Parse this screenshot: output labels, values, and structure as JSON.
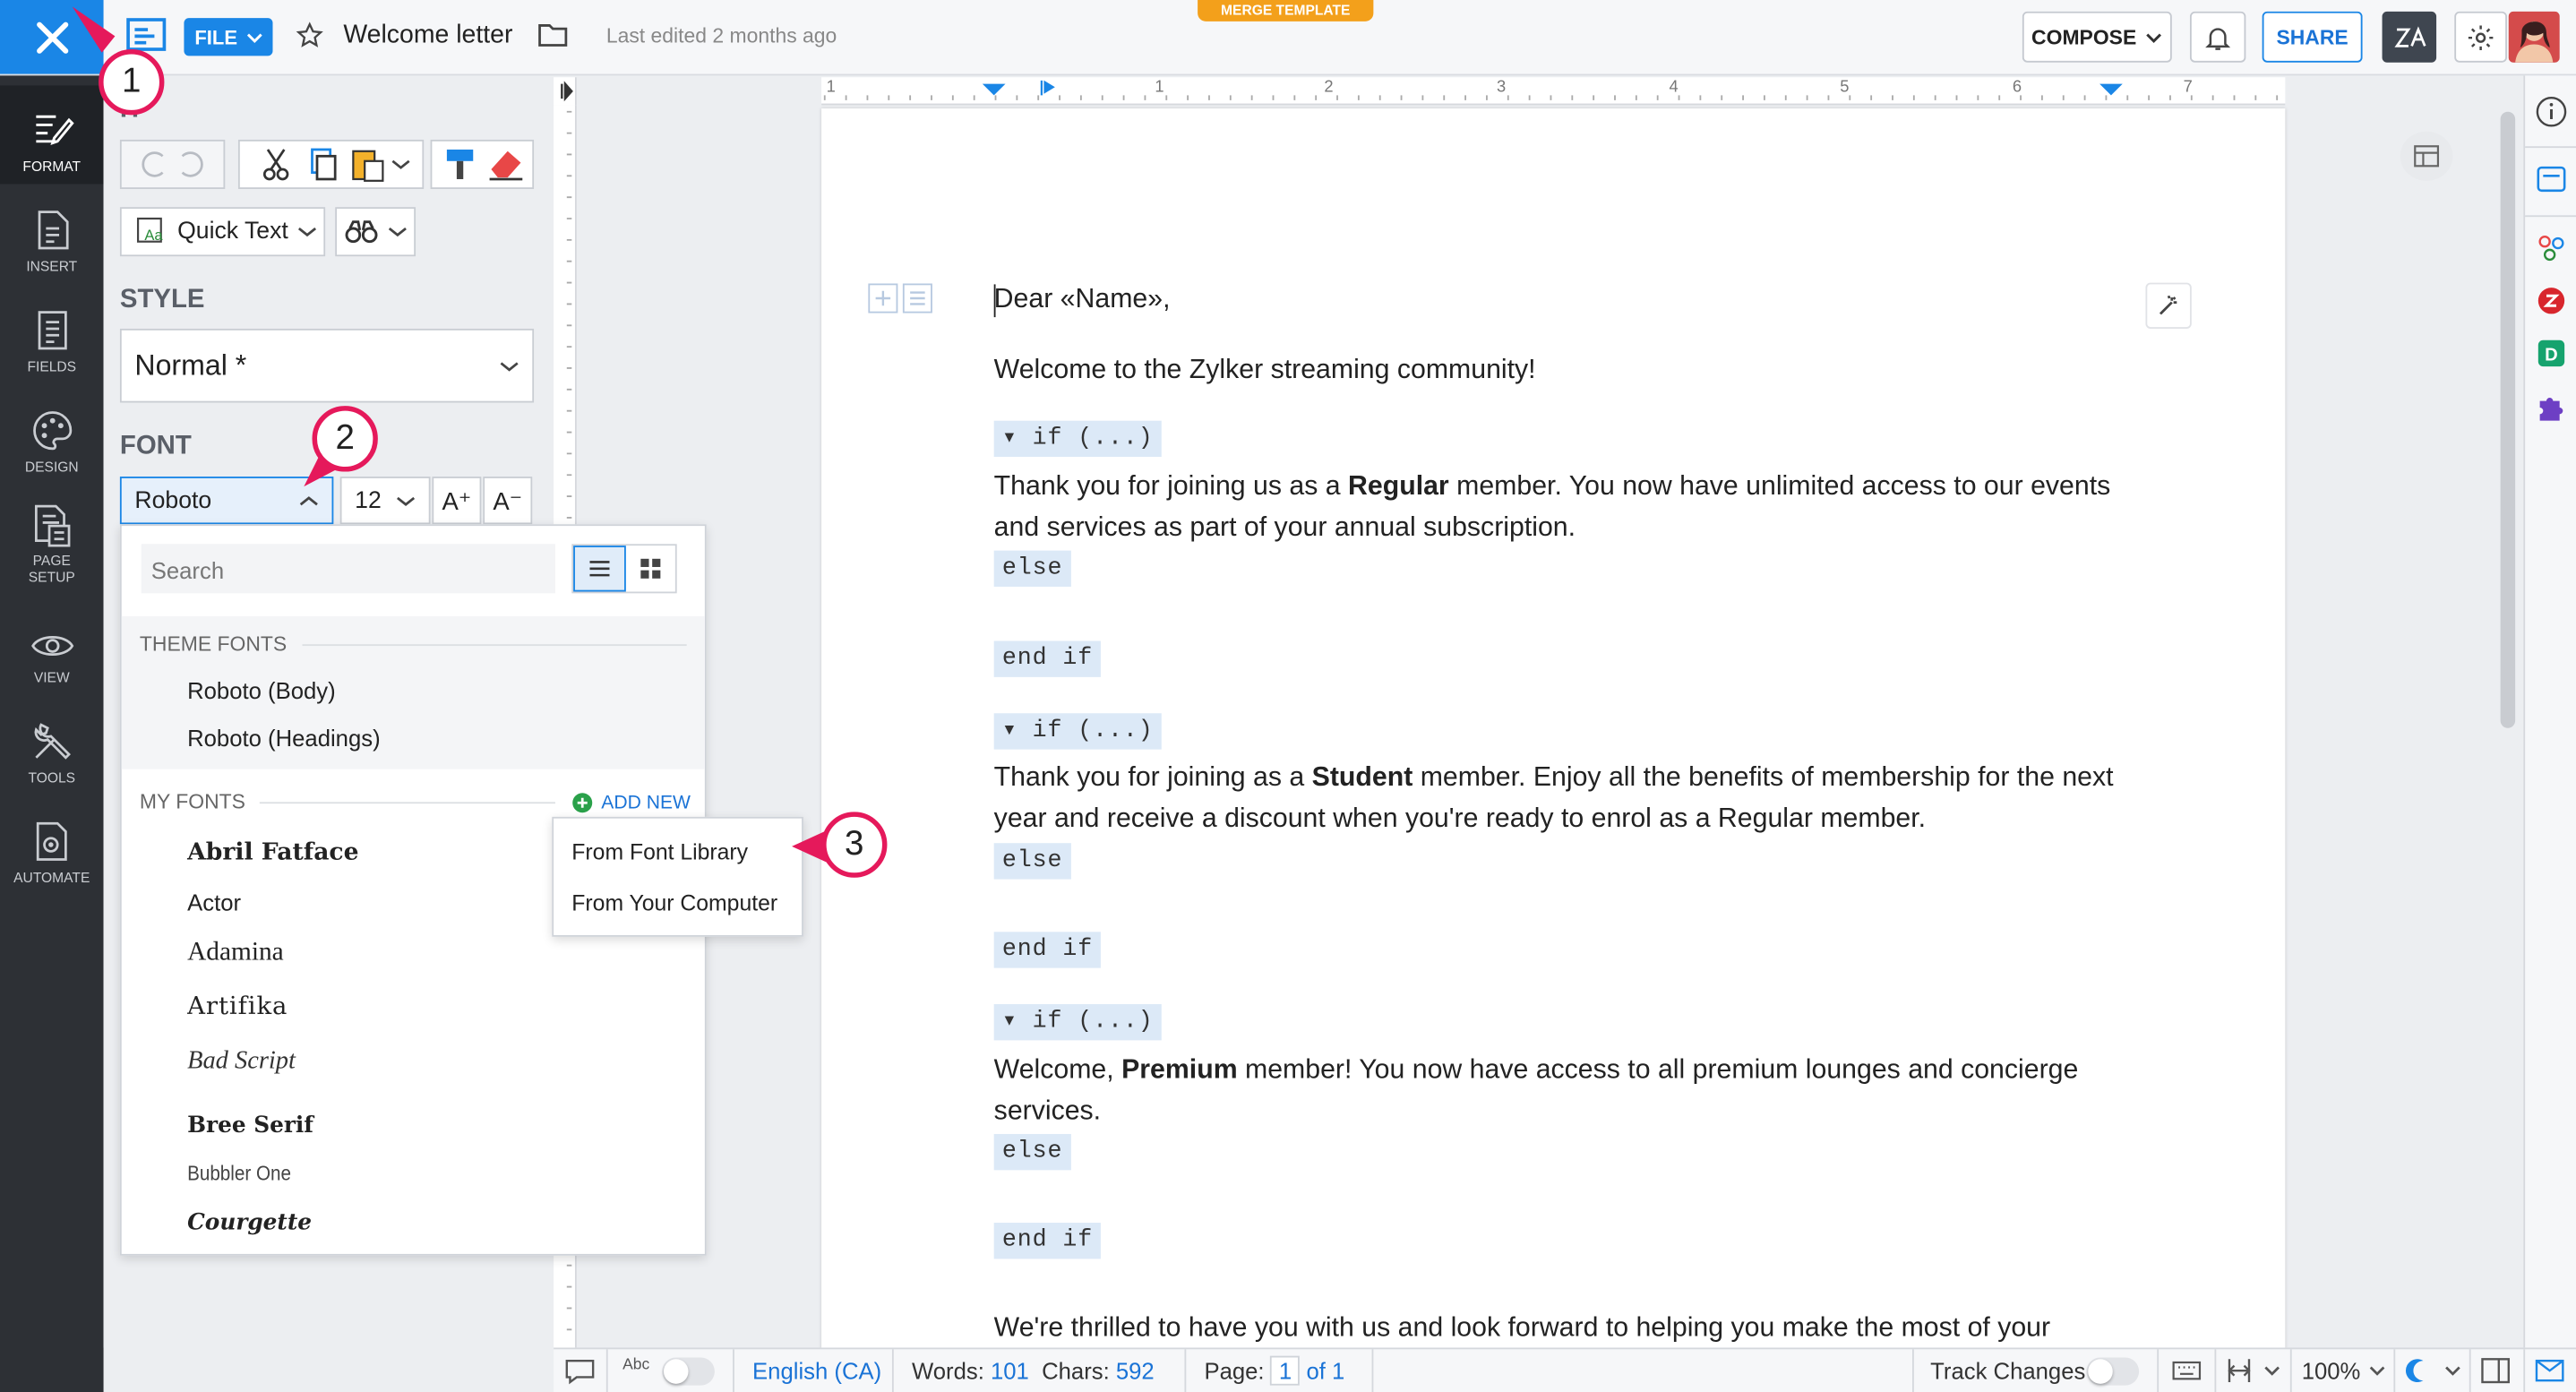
{
  "app": {
    "document_title": "Welcome letter",
    "last_edited": "Last edited 2 months ago",
    "mode_badge": "MERGE TEMPLATE",
    "file_label": "FILE",
    "compose_label": "COMPOSE",
    "share_label": "SHARE",
    "brand_colors": {
      "primary": "#1a86e6",
      "badge": "#f3a01b",
      "annotation": "#e5195b"
    }
  },
  "rail": {
    "items": [
      {
        "label": "FORMAT",
        "icon": "format-icon",
        "active": true
      },
      {
        "label": "INSERT",
        "icon": "insert-icon"
      },
      {
        "label": "FIELDS",
        "icon": "fields-icon"
      },
      {
        "label": "DESIGN",
        "icon": "palette-icon"
      },
      {
        "label": "PAGE\nSETUP",
        "label_line1": "PAGE",
        "label_line2": "SETUP",
        "icon": "page-setup-icon"
      },
      {
        "label": "VIEW",
        "icon": "eye-icon"
      },
      {
        "label": "TOOLS",
        "icon": "tools-icon"
      },
      {
        "label": "AUTOMATE",
        "icon": "automate-icon"
      }
    ]
  },
  "panel": {
    "edit_heading_partial": "IT",
    "quick_text_label": "Quick Text",
    "style_heading": "STYLE",
    "style_value": "Normal *",
    "font_heading": "FONT",
    "font_value": "Roboto",
    "font_size": "12",
    "increase_font_glyph": "A⁺",
    "decrease_font_glyph": "A⁻"
  },
  "font_dropdown": {
    "search_placeholder": "Search",
    "theme_fonts_heading": "THEME FONTS",
    "theme_fonts": [
      "Roboto (Body)",
      "Roboto (Headings)"
    ],
    "my_fonts_heading": "MY FONTS",
    "add_new_label": "ADD NEW",
    "my_fonts": [
      "Abril Fatface",
      "Actor",
      "Adamina",
      "Artifika",
      "Bad Script",
      "Bree Serif",
      "Bubbler One",
      "Courgette"
    ],
    "add_new_menu": [
      "From Font Library",
      "From Your Computer"
    ]
  },
  "annotations": [
    "1",
    "2",
    "3"
  ],
  "ruler": {
    "numbers": [
      "1",
      "1",
      "2",
      "3",
      "4",
      "5",
      "6",
      "7"
    ]
  },
  "document": {
    "greeting": "Dear «Name»,",
    "intro": "Welcome to the Zylker streaming community!",
    "if_label": "if (...)",
    "else_label": "else",
    "end_if_label": "end if",
    "block1_pre": "Thank you for joining us as a ",
    "block1_bold": "Regular",
    "block1_post": " member. You now have unlimited access to our events and services as part of your annual subscription.",
    "block2_pre": "Thank you for joining as a ",
    "block2_bold": "Student",
    "block2_post": " member. Enjoy all the benefits of membership for the next year and receive a discount when you're ready to enrol as a Regular member.",
    "block3_pre": "Welcome, ",
    "block3_bold": "Premium",
    "block3_post": " member! You now have access to all premium lounges and concierge services.",
    "closing_partial": "We're thrilled to have you with us and look forward to helping you make the most of your"
  },
  "status": {
    "language": "English (CA)",
    "words_label": "Words:",
    "words_value": "101",
    "chars_label": "Chars:",
    "chars_value": "592",
    "page_label": "Page:",
    "page_value": "1",
    "page_of": "of 1",
    "track_changes_label": "Track Changes",
    "zoom": "100%"
  }
}
